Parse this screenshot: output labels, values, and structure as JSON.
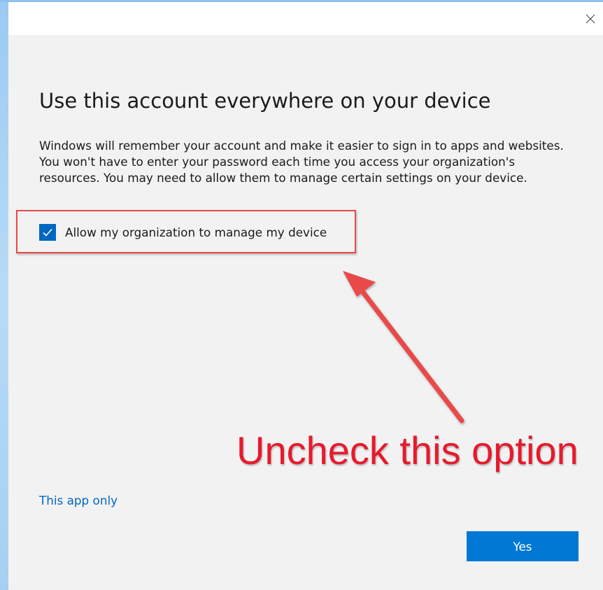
{
  "dialog": {
    "close_icon": "close-icon",
    "heading": "Use this account everywhere on your device",
    "description": "Windows will remember your account and make it easier to sign in to apps and websites. You won't have to enter your password each time you access your organization's resources. You may need to allow them to manage certain settings on your device.",
    "checkbox": {
      "label": "Allow my organization to manage my device",
      "checked": true
    },
    "link_label": "This app only",
    "primary_button_label": "Yes"
  },
  "annotation": {
    "text": "Uncheck this option",
    "color": "#e8192c",
    "highlight_color": "#e9484b"
  },
  "colors": {
    "accent": "#0078d4",
    "link": "#0067c0",
    "dialog_background": "#f2f2f2",
    "titlebar_background": "#ffffff",
    "desktop": "#a9d0f2"
  }
}
